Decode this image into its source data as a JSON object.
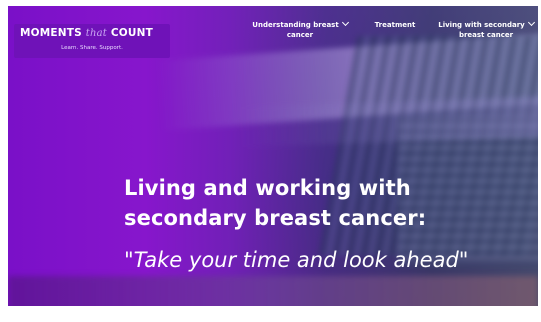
{
  "logo": {
    "title_bold_1": "MOMENTS ",
    "title_script": "that",
    "title_bold_2": " COUNT",
    "tagline": "Learn. Share. Support."
  },
  "nav": {
    "items": [
      {
        "label_line1": "Understanding breast",
        "label_line2": "cancer",
        "has_dropdown": true,
        "icon": "chevron-down-icon"
      },
      {
        "label_line1": "Treatment",
        "label_line2": "",
        "has_dropdown": false
      },
      {
        "label_line1": "Living with secondary",
        "label_line2": "breast cancer",
        "has_dropdown": true,
        "icon": "chevron-down-icon"
      }
    ]
  },
  "hero": {
    "line1": "Living and working with",
    "line2": "secondary breast cancer:",
    "quote": "\"Take your time and look ahead\""
  },
  "colors": {
    "brand_purple": "#6f12b8",
    "overlay_purple": "#8716cc",
    "text": "#ffffff"
  }
}
